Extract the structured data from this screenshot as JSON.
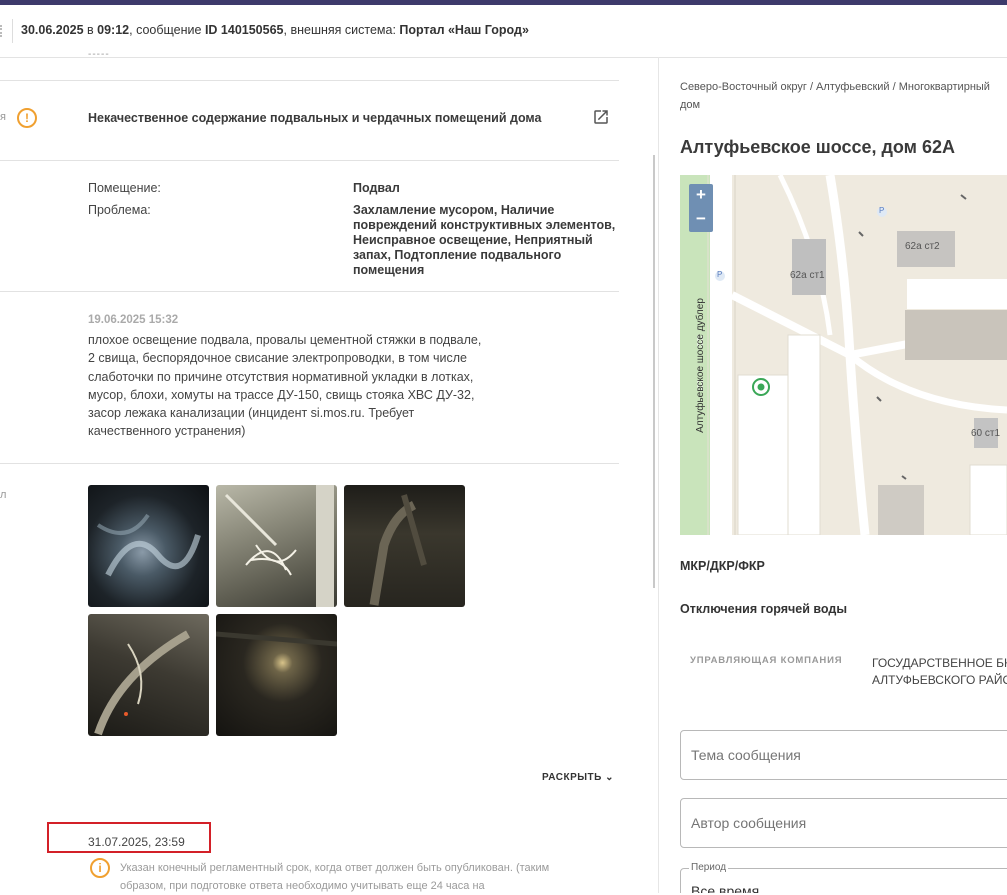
{
  "header": {
    "date": "30.06.2025",
    "in": " в ",
    "time": "09:12",
    "msg_prefix": ", сообщение ",
    "msg_id": "ID 140150565",
    "sys_prefix": ", внешняя система: ",
    "system": "Портал «Наш Город»"
  },
  "left": {
    "dashes": "-----",
    "edge_frag_1": "я",
    "edge_frag_2": "л",
    "subject": "Некачественное содержание подвальных и чердачных помещений дома",
    "details": [
      {
        "label": "Помещение:",
        "value": "Подвал"
      },
      {
        "label": "Проблема:",
        "value": "Захламление мусором, Наличие повреждений конструктивных элементов, Неисправное освещение, Неприятный запах, Подтопление подвального помещения"
      }
    ],
    "message_date": "19.06.2025 15:32",
    "message_text": "плохое освещение подвала, провалы цементной стяжки в подвале, 2 свища, беспорядочное свисание электропроводки, в том числе слаботочки по причине отсутствия нормативной укладки в лотках, мусор, блохи, хомуты на трассе ДУ-150, свищь стояка ХВС ДУ-32, засор лежака канализации (инцидент si.mos.ru. Требует качественного устранения)",
    "expand_label": "РАСКРЫТЬ",
    "deadline": "31.07.2025, 23:59",
    "note": "Указан конечный регламентный срок, когда ответ должен быть опубликован. (таким образом, при подготовке ответа необходимо учитывать еще 24 часа на"
  },
  "right": {
    "breadcrumb_line1": "Северо-Восточный округ / Алтуфьевский / Многоквартирный",
    "breadcrumb_line2": "дом",
    "address": "Алтуфьевское шоссе, дом 62А",
    "map": {
      "street": "Алтуфьевское шоссе дублер",
      "buildings": [
        "62а ст1",
        "62а ст2",
        "60 ст1"
      ],
      "zoom_in": "+",
      "zoom_out": "−",
      "parking": "P"
    },
    "mkr": "МКР/ДКР/ФКР",
    "hot_water": "Отключения горячей воды",
    "mc_label": "УПРАВЛЯЮЩАЯ КОМПАНИЯ",
    "mc_value_1": "ГОСУДАРСТВЕННОЕ БК",
    "mc_value_2": "АЛТУФЬЕВСКОГО РАЙО",
    "topic_placeholder": "Тема сообщения",
    "author_placeholder": "Автор сообщения",
    "period_label": "Период",
    "period_value": "Все время"
  },
  "colors": {
    "accent_bar": "#3d3a6b",
    "warning": "#f0a030",
    "highlight": "#d32028"
  }
}
